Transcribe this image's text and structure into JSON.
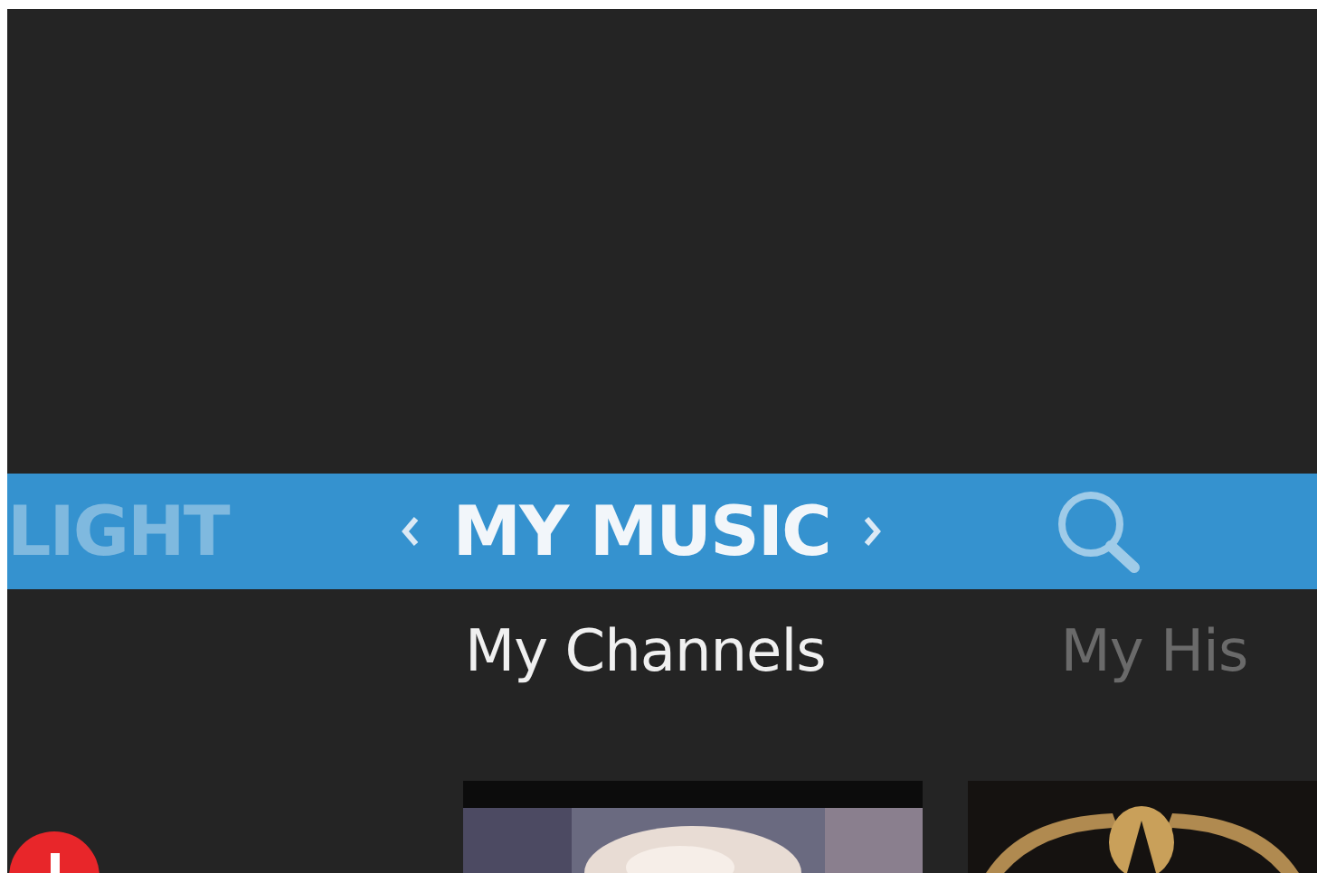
{
  "nav": {
    "sections": [
      {
        "label": "LIGHT",
        "selected": false
      },
      {
        "label": "MY MUSIC",
        "selected": true
      }
    ]
  },
  "tabs": [
    {
      "label": "My Channels",
      "selected": true
    },
    {
      "label": "My His",
      "selected": false
    }
  ]
}
